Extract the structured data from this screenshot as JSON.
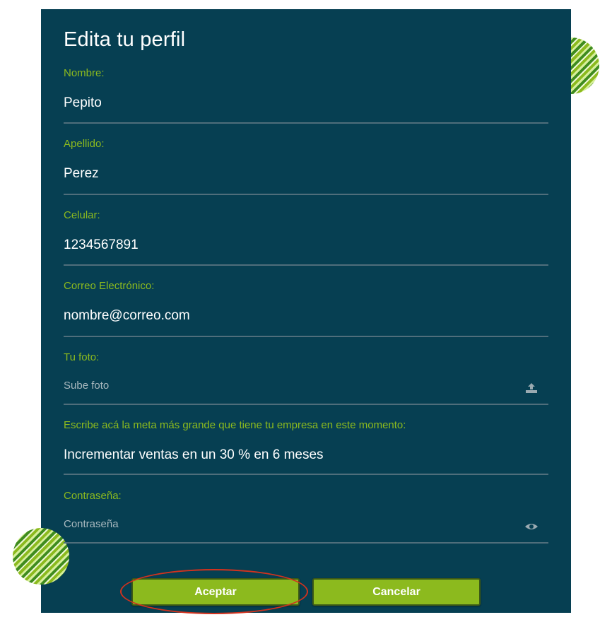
{
  "form": {
    "title": "Edita tu perfil",
    "fields": [
      {
        "label": "Nombre:",
        "value": "Pepito"
      },
      {
        "label": "Apellido:",
        "value": "Perez"
      },
      {
        "label": "Celular:",
        "value": "1234567891"
      },
      {
        "label": "Correo Electrónico:",
        "value": "nombre@correo.com"
      },
      {
        "label": "Tu foto:",
        "placeholder": "Sube foto",
        "icon": "upload-icon"
      },
      {
        "label": "Escribe acá la meta más grande que tiene tu empresa en este momento:",
        "value": "Incrementar ventas en un 30 % en 6 meses"
      },
      {
        "label": "Contraseña:",
        "placeholder": "Contraseña",
        "icon": "eye-icon"
      }
    ]
  },
  "buttons": {
    "accept_label": "Aceptar",
    "cancel_label": "Cancelar"
  },
  "colors": {
    "panel_background": "#063f52",
    "accent_green": "#8cba1e",
    "label_green": "#8cba1e",
    "highlight_red": "#d2321e"
  }
}
